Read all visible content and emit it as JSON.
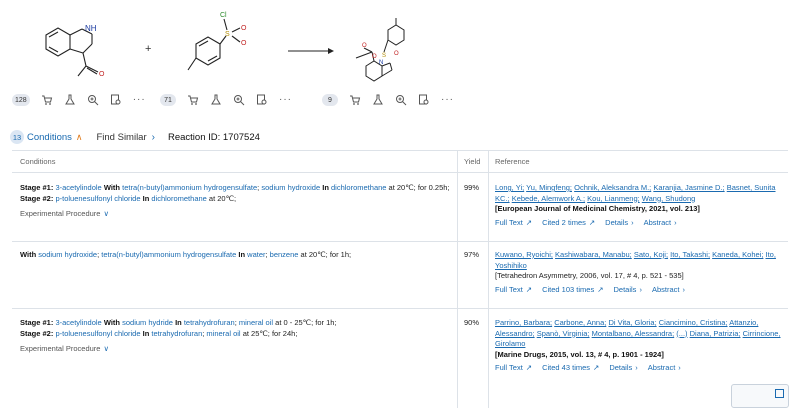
{
  "scheme": {
    "reactant1": {
      "badge": "128",
      "nh_label": "NH",
      "o_label": "O"
    },
    "plus": "+",
    "reactant2": {
      "badge": "71",
      "cl_label": "Cl",
      "s_label": "S",
      "o_label": "O"
    },
    "product": {
      "badge": "9"
    },
    "more": "···"
  },
  "header": {
    "count": "13",
    "title": "Conditions",
    "find_similar": "Find Similar",
    "reaction_id": "Reaction ID: 1707524"
  },
  "table": {
    "col_conditions": "Conditions",
    "col_yield": "Yield",
    "col_reference": "Reference",
    "rows": [
      {
        "yield": "99%",
        "s1_label": "Stage #1:",
        "s1_reagent": "3-acetylindole",
        "s1_with": "With",
        "s1_r2": "tetra(n-butyl)ammonium hydrogensulfate",
        "s1_sep1": ";",
        "s1_r3": "sodium hydroxide",
        "s1_in": "In",
        "s1_solvent": "dichloromethane",
        "s1_cond": "at 20℃; for 0.25h;",
        "s2_label": "Stage #2:",
        "s2_reagent": "p-toluenesulfonyl chloride",
        "s2_in": "In",
        "s2_solvent": "dichloromethane",
        "s2_cond": "at 20℃;",
        "exp": "Experimental Procedure",
        "authors": [
          "Long, Yi;",
          "Yu, Mingfeng;",
          "Ochnik, Aleksandra M.;",
          "Karanjia, Jasmine D.;",
          "Basnet, Sunita KC.;",
          "Kebede, Alemwork A.;",
          "Kou, Lianmeng;",
          "Wang, Shudong"
        ],
        "journal": "[European Journal of Medicinal Chemistry, 2021, vol. 213]",
        "full_text": "Full Text",
        "cited": "Cited 2 times",
        "details": "Details",
        "abstract": "Abstract"
      },
      {
        "yield": "97%",
        "with": "With",
        "r1": "sodium hydroxide",
        "r2": "tetra(n-butyl)ammonium hydrogensulfate",
        "in": "In",
        "solv1": "water",
        "solv2": "benzene",
        "cond": "at 20℃; for 1h;",
        "authors": [
          "Kuwano, Ryoichi;",
          "Kashiwabara, Manabu;",
          "Sato, Koji;",
          "Ito, Takashi;",
          "Kaneda, Kohei;",
          "Ito, Yoshihiko"
        ],
        "journal": "[Tetrahedron Asymmetry, 2006, vol. 17, # 4, p. 521 - 535]",
        "full_text": "Full Text",
        "cited": "Cited 103 times",
        "details": "Details",
        "abstract": "Abstract"
      },
      {
        "yield": "90%",
        "s1_label": "Stage #1:",
        "s1_reagent": "3-acetylindole",
        "s1_with": "With",
        "s1_r2": "sodium hydride",
        "s1_in": "In",
        "s1_solv1": "tetrahydrofuran",
        "s1_solv2": "mineral oil",
        "s1_cond": "at 0 - 25℃; for 1h;",
        "s2_label": "Stage #2:",
        "s2_reagent": "p-toluenesulfonyl chloride",
        "s2_in": "In",
        "s2_solv1": "tetrahydrofuran",
        "s2_solv2": "mineral oil",
        "s2_cond": "at 25℃; for 24h;",
        "exp": "Experimental Procedure",
        "authors": [
          "Parrino, Barbara;",
          "Carbone, Anna;",
          "Di Vita, Gloria;",
          "Ciancimino, Cristina;",
          "Attanzio, Alessandro;",
          "Spanò, Virginia;",
          "Montalbano, Alessandra;",
          "(...)",
          "Diana, Patrizia;",
          "Cirrincione, Girolamo"
        ],
        "journal": "[Marine Drugs, 2015, vol. 13, # 4, p. 1901 - 1924]",
        "full_text": "Full Text",
        "cited": "Cited 43 times",
        "details": "Details",
        "abstract": "Abstract"
      }
    ]
  },
  "colors": {
    "link": "#1a6ab0",
    "accent_orange": "#e07a1a",
    "divider": "#dde2e8"
  }
}
